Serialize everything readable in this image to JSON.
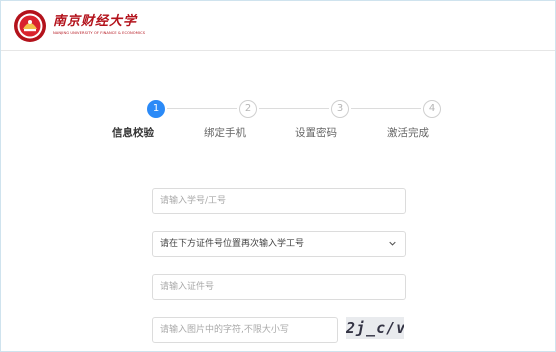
{
  "header": {
    "logo_name_cn": "南京财经大学",
    "logo_name_en": "NANJING UNIVERSITY OF FINANCE & ECONOMICS",
    "brand_color": "#b3121b"
  },
  "steps": [
    {
      "number": "1",
      "label": "信息校验",
      "state": "active"
    },
    {
      "number": "2",
      "label": "绑定手机",
      "state": "pending"
    },
    {
      "number": "3",
      "label": "设置密码",
      "state": "pending"
    },
    {
      "number": "4",
      "label": "激活完成",
      "state": "pending"
    }
  ],
  "accent_color": "#2b8af7",
  "form": {
    "id_input_placeholder": "请输入学号/工号",
    "select_value": "请在下方证件号位置再次输入学工号",
    "cert_input_placeholder": "请输入证件号",
    "captcha_input_placeholder": "请输入图片中的字符,不限大小写",
    "captcha_text": "2j_c/v"
  }
}
